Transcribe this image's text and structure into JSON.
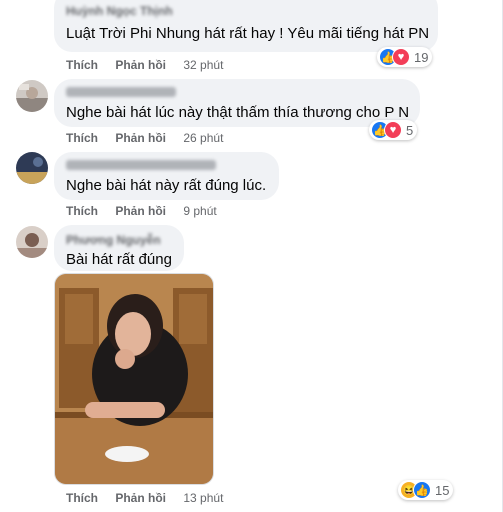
{
  "comments": [
    {
      "author": "Huỳnh Ngọc Thịnh",
      "text": "Luật Trời Phi Nhung hát rất hay ! Yêu mãi tiếng hát PN",
      "like_label": "Thích",
      "reply_label": "Phản hồi",
      "time": "32 phút",
      "reaction_count": "19"
    },
    {
      "author": "",
      "text": "Nghe bài hát lúc này thật thấm thía thương cho P N",
      "like_label": "Thích",
      "reply_label": "Phản hồi",
      "time": "26 phút",
      "reaction_count": "5"
    },
    {
      "author": "",
      "text": "Nghe bài hát này rất đúng lúc.",
      "like_label": "Thích",
      "reply_label": "Phản hồi",
      "time": "9 phút"
    },
    {
      "author": "Phương Nguyễn",
      "text": "Bài hát rất đúng",
      "like_label": "Thích",
      "reply_label": "Phản hồi",
      "time": "13 phút",
      "reaction_count": "15"
    }
  ],
  "icons": {
    "like": "thumbs-up-icon",
    "love": "heart-icon",
    "haha": "laughing-face-icon"
  },
  "colors": {
    "bubble": "#f0f2f5",
    "like": "#1877f2",
    "love": "#f33e58",
    "haha": "#f7b125",
    "meta": "#65676b"
  }
}
